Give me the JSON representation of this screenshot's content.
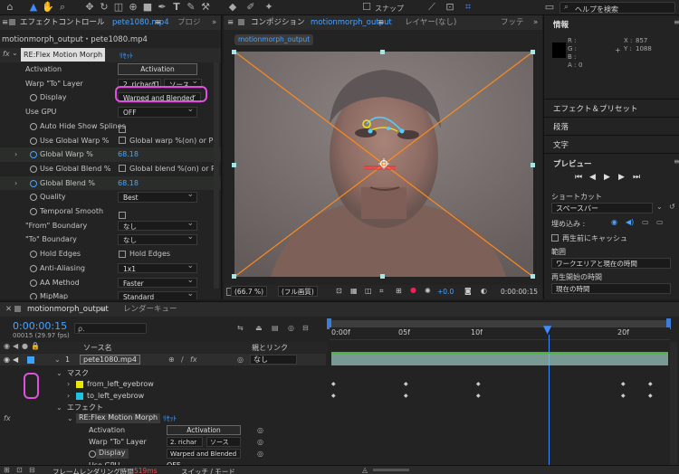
{
  "toolbar": {
    "snap_label": "スナップ",
    "help_search_placeholder": "ヘルプを検索"
  },
  "effect_controls": {
    "tab_label": "エフェクトコントロール",
    "tab_layer": "pete1080.mp4",
    "tab_menu": "≡",
    "next_tab": "プロジ",
    "breadcrumb": "motionmorph_output・pete1080.mp4",
    "effect_name": "RE:Flex Motion Morph",
    "reset_label": "ﾘｾｯﾄ",
    "rows": [
      {
        "label": "Activation",
        "button": "Activation"
      },
      {
        "label": "Warp \"To\" Layer",
        "value": "2. richard1",
        "value2": "ソース"
      },
      {
        "label": "Display",
        "value": "Warped and Blended"
      },
      {
        "label": "Use GPU",
        "value": "OFF"
      },
      {
        "label": "Auto Hide Show Splines"
      },
      {
        "label": "Use Global Warp %",
        "value": "Global warp %(on) or P"
      },
      {
        "label": "Global Warp %",
        "value": "68.18"
      },
      {
        "label": "Use Global Blend %",
        "value": "Global blend %(on) or P"
      },
      {
        "label": "Global Blend %",
        "value": "68.18"
      },
      {
        "label": "Quality",
        "value": "Best"
      },
      {
        "label": "Temporal Smooth"
      },
      {
        "label": "\"From\" Boundary",
        "value": "なし"
      },
      {
        "label": "\"To\" Boundary",
        "value": "なし"
      },
      {
        "label": "Hold Edges",
        "value": "Hold Edges"
      },
      {
        "label": "Anti-Aliasing",
        "value": "1x1"
      },
      {
        "label": "AA Method",
        "value": "Faster"
      },
      {
        "label": "MipMap",
        "value": "Standard"
      }
    ]
  },
  "composition": {
    "tab_label": "コンポジション",
    "comp_name": "motionmorph_output",
    "layer_tab": "レイヤー(なし)",
    "footage_tab": "フッテ",
    "breadcrumb": "motionmorph_output",
    "zoom": "(66.7 %)",
    "resolution": "(フル画質)",
    "exposure": "+0.0",
    "timecode": "0:00:00:15"
  },
  "info": {
    "title": "情報",
    "r_label": "R :",
    "g_label": "G :",
    "b_label": "B :",
    "a_label": "A :",
    "a_value": "0",
    "x_label": "X :",
    "x_value": "857",
    "y_label": "Y :",
    "y_value": "1088"
  },
  "right_sections": {
    "effects_presets": "エフェクト＆プリセット",
    "paragraph": "段落",
    "character": "文字",
    "preview": "プレビュー",
    "shortcut_label": "ショートカット",
    "shortcut_value": "スペースバー",
    "embed_label": "埋め込み :",
    "cache_label": "再生前にキャッシュ",
    "range_label": "範囲",
    "range_value": "ワークエリアと現在の時間",
    "start_label": "再生開始の時間",
    "start_value": "現在の時間"
  },
  "timeline": {
    "comp_tab": "motionmorph_output",
    "render_queue_tab": "レンダーキュー",
    "timecode": "0:00:00:15",
    "fps": "00015 (29.97 fps)",
    "search_placeholder": "ρ.",
    "col_source": "ソース名",
    "col_parent": "親とリンク",
    "ruler": [
      "0:00f",
      "05f",
      "10f",
      "20f"
    ],
    "layer_num": "1",
    "layer_name": "pete1080.mp4",
    "parent_value": "なし",
    "mask_group": "マスク",
    "masks": [
      {
        "name": "from_left_eyebrow",
        "color": "#e8e800"
      },
      {
        "name": "to_left_eyebrow",
        "color": "#22c3e0"
      }
    ],
    "effects_group": "エフェクト",
    "effect_name": "RE:Flex Motion Morph",
    "reset_label": "ﾘｾｯﾄ",
    "prop_rows": [
      {
        "label": "Activation",
        "value": "Activation"
      },
      {
        "label": "Warp \"To\" Layer",
        "value": "2. richar",
        "value2": "ソース"
      },
      {
        "label": "Display",
        "value": "Warped and Blended"
      },
      {
        "label": "Use GPU",
        "value": "OFF"
      }
    ],
    "render_time_label": "フレームレンダリング時間",
    "render_time_value": "519ms",
    "switch_mode": "スイッチ / モード"
  }
}
